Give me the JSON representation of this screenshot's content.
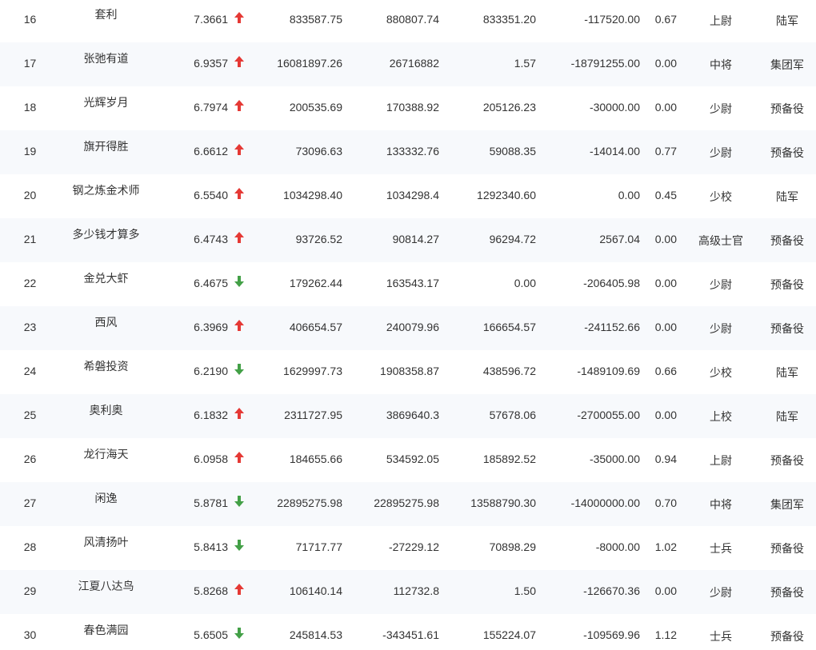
{
  "colors": {
    "up": "#e53935",
    "down": "#43a047",
    "text": "#333333",
    "row_alt": "#f7f9fc"
  },
  "rows": [
    {
      "rank": "16",
      "name": "套利",
      "score": "7.3661",
      "trend": "up",
      "v1": "833587.75",
      "v2": "880807.74",
      "v3": "833351.20",
      "v4": "-117520.00",
      "ratio": "0.67",
      "grade": "上尉",
      "branch": "陆军"
    },
    {
      "rank": "17",
      "name": "张弛有道",
      "score": "6.9357",
      "trend": "up",
      "v1": "16081897.26",
      "v2": "26716882",
      "v3": "1.57",
      "v4": "-18791255.00",
      "ratio": "0.00",
      "grade": "中将",
      "branch": "集团军"
    },
    {
      "rank": "18",
      "name": "光辉岁月",
      "score": "6.7974",
      "trend": "up",
      "v1": "200535.69",
      "v2": "170388.92",
      "v3": "205126.23",
      "v4": "-30000.00",
      "ratio": "0.00",
      "grade": "少尉",
      "branch": "预备役"
    },
    {
      "rank": "19",
      "name": "旗开得胜",
      "score": "6.6612",
      "trend": "up",
      "v1": "73096.63",
      "v2": "133332.76",
      "v3": "59088.35",
      "v4": "-14014.00",
      "ratio": "0.77",
      "grade": "少尉",
      "branch": "预备役"
    },
    {
      "rank": "20",
      "name": "钢之炼金术师",
      "score": "6.5540",
      "trend": "up",
      "v1": "1034298.40",
      "v2": "1034298.4",
      "v3": "1292340.60",
      "v4": "0.00",
      "ratio": "0.45",
      "grade": "少校",
      "branch": "陆军"
    },
    {
      "rank": "21",
      "name": "多少钱才算多",
      "score": "6.4743",
      "trend": "up",
      "v1": "93726.52",
      "v2": "90814.27",
      "v3": "96294.72",
      "v4": "2567.04",
      "ratio": "0.00",
      "grade": "高级士官",
      "branch": "预备役"
    },
    {
      "rank": "22",
      "name": "金兑大虾",
      "score": "6.4675",
      "trend": "down",
      "v1": "179262.44",
      "v2": "163543.17",
      "v3": "0.00",
      "v4": "-206405.98",
      "ratio": "0.00",
      "grade": "少尉",
      "branch": "预备役"
    },
    {
      "rank": "23",
      "name": "西风",
      "score": "6.3969",
      "trend": "up",
      "v1": "406654.57",
      "v2": "240079.96",
      "v3": "166654.57",
      "v4": "-241152.66",
      "ratio": "0.00",
      "grade": "少尉",
      "branch": "预备役"
    },
    {
      "rank": "24",
      "name": "希磐投资",
      "score": "6.2190",
      "trend": "down",
      "v1": "1629997.73",
      "v2": "1908358.87",
      "v3": "438596.72",
      "v4": "-1489109.69",
      "ratio": "0.66",
      "grade": "少校",
      "branch": "陆军"
    },
    {
      "rank": "25",
      "name": "奥利奥",
      "score": "6.1832",
      "trend": "up",
      "v1": "2311727.95",
      "v2": "3869640.3",
      "v3": "57678.06",
      "v4": "-2700055.00",
      "ratio": "0.00",
      "grade": "上校",
      "branch": "陆军"
    },
    {
      "rank": "26",
      "name": "龙行海天",
      "score": "6.0958",
      "trend": "up",
      "v1": "184655.66",
      "v2": "534592.05",
      "v3": "185892.52",
      "v4": "-35000.00",
      "ratio": "0.94",
      "grade": "上尉",
      "branch": "预备役"
    },
    {
      "rank": "27",
      "name": "闲逸",
      "score": "5.8781",
      "trend": "down",
      "v1": "22895275.98",
      "v2": "22895275.98",
      "v3": "13588790.30",
      "v4": "-14000000.00",
      "ratio": "0.70",
      "grade": "中将",
      "branch": "集团军"
    },
    {
      "rank": "28",
      "name": "风清扬叶",
      "score": "5.8413",
      "trend": "down",
      "v1": "71717.77",
      "v2": "-27229.12",
      "v3": "70898.29",
      "v4": "-8000.00",
      "ratio": "1.02",
      "grade": "士兵",
      "branch": "预备役"
    },
    {
      "rank": "29",
      "name": "江夏八达鸟",
      "score": "5.8268",
      "trend": "up",
      "v1": "106140.14",
      "v2": "112732.8",
      "v3": "1.50",
      "v4": "-126670.36",
      "ratio": "0.00",
      "grade": "少尉",
      "branch": "预备役"
    },
    {
      "rank": "30",
      "name": "春色满园",
      "score": "5.6505",
      "trend": "down",
      "v1": "245814.53",
      "v2": "-343451.61",
      "v3": "155224.07",
      "v4": "-109569.96",
      "ratio": "1.12",
      "grade": "士兵",
      "branch": "预备役"
    }
  ]
}
